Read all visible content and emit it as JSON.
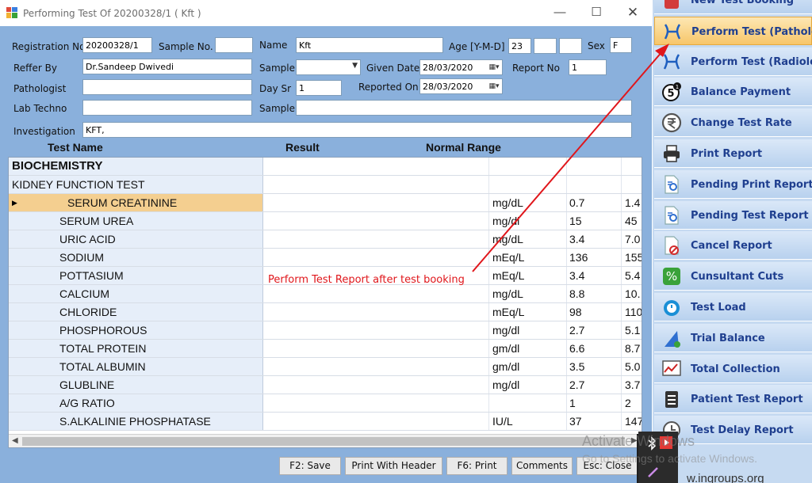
{
  "window": {
    "title": "Performing Test Of  20200328/1 ( Kft )",
    "min_glyph": "—",
    "max_glyph": "☐",
    "close_glyph": "✕"
  },
  "form": {
    "registration_label": "Registration No.",
    "registration_value": "20200328/1",
    "sample_no_label": "Sample No.",
    "sample_no_value": "",
    "name_label": "Name",
    "name_value": "Kft",
    "age_label": "Age [Y-M-D]",
    "age_y": "23",
    "age_m": "",
    "age_d": "",
    "sex_label": "Sex",
    "sex_value": "F",
    "reffer_label": "Reffer By",
    "reffer_value": "Dr.Sandeep Dwivedi",
    "sample_label": "Sample",
    "sample_value": "",
    "given_date_label": "Given Date",
    "given_date_value": "28/03/2020",
    "report_no_label": "Report No",
    "report_no_value": "1",
    "pathologist_label": "Pathologist",
    "pathologist_value": "",
    "day_sr_label": "Day Sr",
    "day_sr_value": "1",
    "reported_on_label": "Reported On",
    "reported_on_value": "28/03/2020",
    "lab_techno_label": "Lab Techno",
    "lab_techno_value": "",
    "sample2_label": "Sample",
    "sample2_value": "",
    "investigation_label": "Investigation",
    "investigation_value": "KFT,"
  },
  "grid": {
    "headers": {
      "test_name": "Test Name",
      "result": "Result",
      "normal_range": "Normal Range"
    },
    "rows": [
      {
        "name": "BIOCHEMISTRY",
        "indent": 4,
        "bold": true,
        "unit": "",
        "low": "",
        "high": ""
      },
      {
        "name": "KIDNEY FUNCTION TEST",
        "indent": 4,
        "bold": false,
        "unit": "",
        "low": "",
        "high": ""
      },
      {
        "name": "SERUM CREATININE",
        "indent": 74,
        "bold": false,
        "unit": "mg/dL",
        "low": "0.7",
        "high": "1.4",
        "selected": true
      },
      {
        "name": "SERUM UREA",
        "indent": 64,
        "bold": false,
        "unit": "mg/dl",
        "low": "15",
        "high": "45"
      },
      {
        "name": "URIC ACID",
        "indent": 64,
        "bold": false,
        "unit": "mg/dL",
        "low": "3.4",
        "high": "7.0"
      },
      {
        "name": "SODIUM",
        "indent": 64,
        "bold": false,
        "unit": "mEq/L",
        "low": "136",
        "high": "155"
      },
      {
        "name": "POTTASIUM",
        "indent": 64,
        "bold": false,
        "unit": "mEq/L",
        "low": "3.4",
        "high": "5.4"
      },
      {
        "name": "CALCIUM",
        "indent": 64,
        "bold": false,
        "unit": "mg/dL",
        "low": "8.8",
        "high": "10."
      },
      {
        "name": "CHLORIDE",
        "indent": 64,
        "bold": false,
        "unit": "mEq/L",
        "low": "98",
        "high": "110"
      },
      {
        "name": "PHOSPHOROUS",
        "indent": 64,
        "bold": false,
        "unit": "mg/dl",
        "low": "2.7",
        "high": "5.1"
      },
      {
        "name": "TOTAL PROTEIN",
        "indent": 64,
        "bold": false,
        "unit": "gm/dl",
        "low": "6.6",
        "high": "8.7"
      },
      {
        "name": "TOTAL ALBUMIN",
        "indent": 64,
        "bold": false,
        "unit": "gm/dl",
        "low": "3.5",
        "high": "5.0"
      },
      {
        "name": "GLUBLINE",
        "indent": 64,
        "bold": false,
        "unit": "mg/dl",
        "low": "2.7",
        "high": "3.7"
      },
      {
        "name": "A/G RATIO",
        "indent": 64,
        "bold": false,
        "unit": "",
        "low": "1",
        "high": "2"
      },
      {
        "name": "S.ALKALINIE PHOSPHATASE",
        "indent": 64,
        "bold": false,
        "unit": "IU/L",
        "low": "37",
        "high": "147"
      }
    ]
  },
  "buttons": {
    "save": "F2: Save",
    "print_header": "Print With Header",
    "print": "F6: Print",
    "comments": "Comments",
    "close": "Esc: Close"
  },
  "menu": [
    {
      "label": "New Test Booking",
      "icon": "booking-icon",
      "color": "#d23b3b"
    },
    {
      "label": "Perform Test (Pathology)",
      "icon": "pathology-icon",
      "color": "#1f5fbf",
      "active": true
    },
    {
      "label": "Perform Test (Radiology)",
      "icon": "radiology-icon",
      "color": "#1f5fbf"
    },
    {
      "label": "Balance Payment",
      "icon": "balance-icon",
      "color": "#111111"
    },
    {
      "label": "Change Test Rate",
      "icon": "rupee-icon",
      "color": "#555555"
    },
    {
      "label": "Print Report",
      "icon": "printer-icon",
      "color": "#333333"
    },
    {
      "label": "Pending Print Report",
      "icon": "document-search-icon",
      "color": "#2f6fd0"
    },
    {
      "label": "Pending Test Report",
      "icon": "document-search-icon",
      "color": "#2f6fd0"
    },
    {
      "label": "Cancel Report",
      "icon": "cancel-document-icon",
      "color": "#d22c2c"
    },
    {
      "label": "Cunsultant Cuts",
      "icon": "percent-icon",
      "color": "#3aa23a"
    },
    {
      "label": "Test Load",
      "icon": "stopwatch-icon",
      "color": "#1a8fd6"
    },
    {
      "label": "Trial Balance",
      "icon": "trial-balance-icon",
      "color": "#3aa23a"
    },
    {
      "label": "Total Collection",
      "icon": "chart-icon",
      "color": "#c22"
    },
    {
      "label": "Patient Test Report",
      "icon": "clipboard-icon",
      "color": "#333333"
    },
    {
      "label": "Test Delay Report",
      "icon": "delay-icon",
      "color": "#555555"
    }
  ],
  "overlay": {
    "annotation": "Perform Test Report after test booking",
    "watermark_line1": "Activate Windows",
    "watermark_line2": "Go to Settings to activate Windows.",
    "footer_url": "w.ingroups.org",
    "badge_count": "5",
    "badge_dot": "1",
    "arrow_color": "#e0161b"
  }
}
